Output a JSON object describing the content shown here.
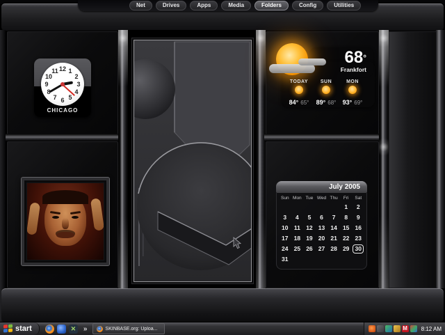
{
  "menu": {
    "tabs": [
      {
        "label": "Net",
        "active": false
      },
      {
        "label": "Drives",
        "active": false
      },
      {
        "label": "Apps",
        "active": false
      },
      {
        "label": "Media",
        "active": false
      },
      {
        "label": "Folders",
        "active": true
      },
      {
        "label": "Config",
        "active": false
      },
      {
        "label": "Utilities",
        "active": false
      }
    ]
  },
  "clock": {
    "city": "CHICAGO",
    "numerals": [
      "12",
      "1",
      "2",
      "3",
      "4",
      "5",
      "6",
      "7",
      "8",
      "9",
      "10",
      "11"
    ],
    "time_shown": "2:40"
  },
  "weather": {
    "current_temp": "68",
    "degree_symbol": "°",
    "location": "Frankfort",
    "forecast": [
      {
        "day": "TODAY",
        "high": "84°",
        "low": "65°"
      },
      {
        "day": "SUN",
        "high": "89°",
        "low": "68°"
      },
      {
        "day": "MON",
        "high": "93°",
        "low": "69°"
      }
    ]
  },
  "calendar": {
    "title": "July 2005",
    "day_headers": [
      "Sun",
      "Mon",
      "Tue",
      "Wed",
      "Thu",
      "Fri",
      "Sat"
    ],
    "cells": [
      "",
      "",
      "",
      "",
      "",
      "1",
      "2",
      "3",
      "4",
      "5",
      "6",
      "7",
      "8",
      "9",
      "10",
      "11",
      "12",
      "13",
      "14",
      "15",
      "16",
      "17",
      "18",
      "19",
      "20",
      "21",
      "22",
      "23",
      "24",
      "25",
      "26",
      "27",
      "28",
      "29",
      "30",
      "31",
      "",
      "",
      "",
      "",
      "",
      ""
    ],
    "selected_day": "30"
  },
  "taskbar": {
    "start_label": "start",
    "overflow_chevron": "»",
    "quicklaunch_icons": [
      "firefox-icon",
      "blue-app-icon",
      "x-app-icon"
    ],
    "x_app_glyph": "✕",
    "task_buttons": [
      {
        "label": "SKINBASE.org: Uploa...",
        "icon": "firefox-icon"
      }
    ],
    "tray_icons": [
      "flame-icon",
      "gray-app-icon",
      "color-app-icon",
      "gold-app-icon",
      "m-red-icon",
      "multicolor-app-icon"
    ],
    "tray_m_glyph": "M",
    "tray_time": "8:12 AM"
  },
  "colors": {
    "accent_sun_orange": "#f59300",
    "second_hand_red": "#d42a22",
    "panel_black": "#0b0b0c",
    "metal_gray": "#87878c",
    "flag_red": "#e8362d",
    "flag_green": "#7cbb3f",
    "flag_blue": "#3573cf",
    "flag_yellow": "#f7b90f",
    "m_icon_red": "#c01622"
  }
}
